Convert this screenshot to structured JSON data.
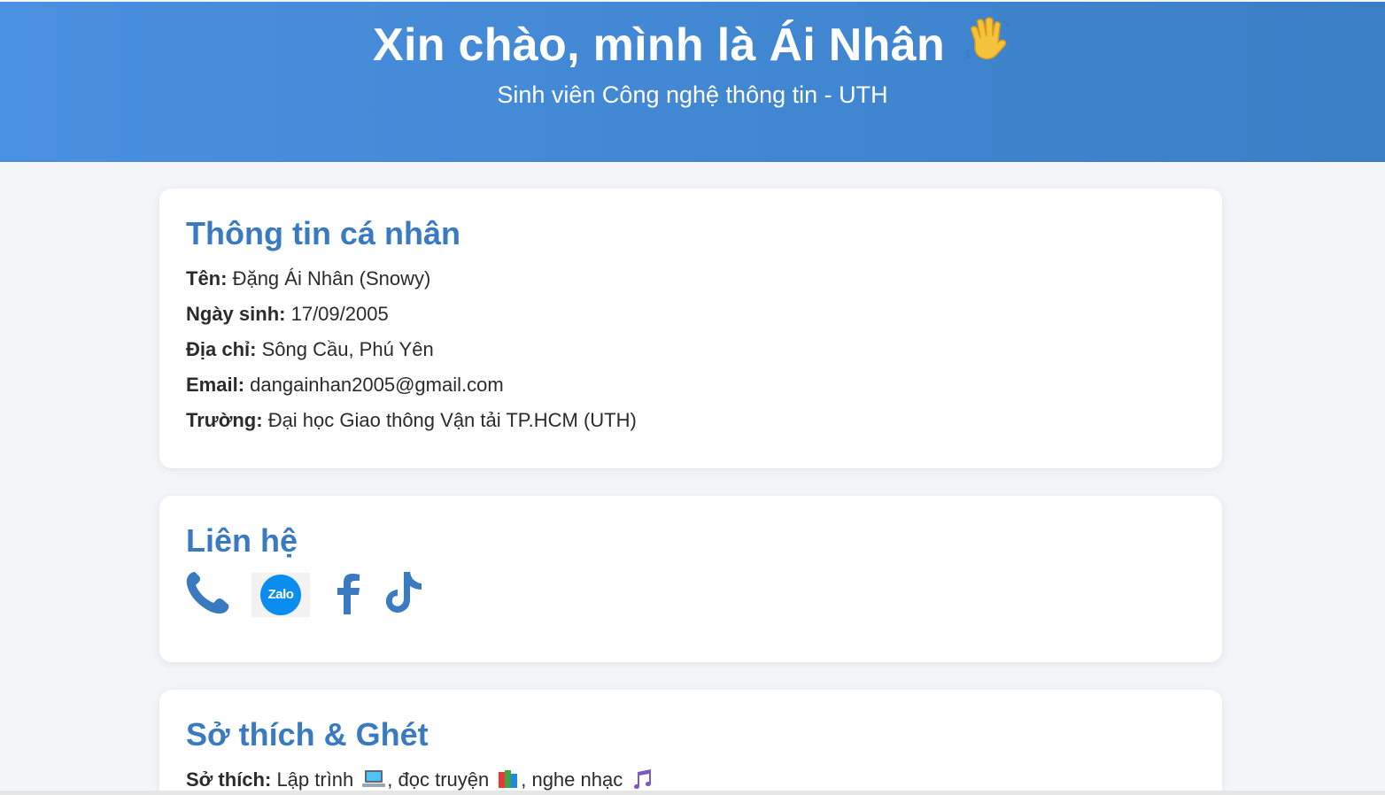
{
  "header": {
    "title": "Xin chào, mình là Ái Nhân",
    "wave_icon": "waving-hand",
    "subtitle": "Sinh viên Công nghệ thông tin - UTH",
    "gradient_start": "#4a90e0",
    "gradient_end": "#3a7fc6"
  },
  "personal": {
    "heading": "Thông tin cá nhân",
    "rows": [
      {
        "label": "Tên:",
        "value": "Đặng Ái Nhân (Snowy)"
      },
      {
        "label": "Ngày sinh:",
        "value": "17/09/2005"
      },
      {
        "label": "Địa chỉ:",
        "value": "Sông Cầu, Phú Yên"
      },
      {
        "label": "Email:",
        "value": "dangainhan2005@gmail.com"
      },
      {
        "label": "Trường:",
        "value": "Đại học Giao thông Vận tải TP.HCM (UTH)"
      }
    ]
  },
  "contact": {
    "heading": "Liên hệ",
    "icons": [
      "phone-icon",
      "zalo-icon",
      "facebook-icon",
      "tiktok-icon"
    ],
    "zalo_label": "Zalo",
    "accent": "#3a7ac0"
  },
  "hobbies": {
    "heading": "Sở thích & Ghét",
    "label": "Sở thích:",
    "items": [
      "Lập trình",
      ", đọc truyện",
      ", nghe nhạc"
    ],
    "item_icons": [
      "laptop-icon",
      "books-icon",
      "music-notes-icon"
    ]
  }
}
